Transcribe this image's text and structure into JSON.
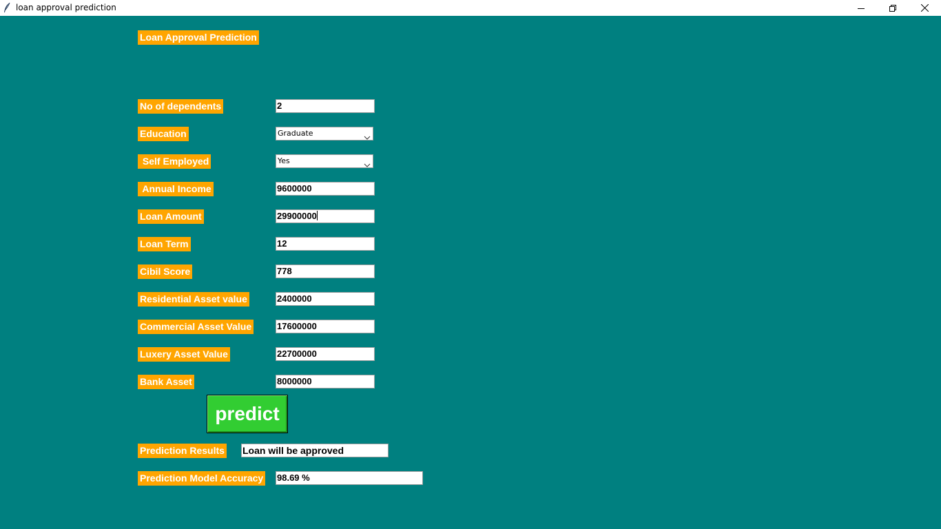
{
  "window": {
    "title": "loan approval prediction"
  },
  "header": {
    "title": "Loan Approval Prediction"
  },
  "form": {
    "dependents_label": "No of dependents",
    "dependents_value": "2",
    "education_label": "Education",
    "education_value": "Graduate",
    "self_employed_label": " Self Employed",
    "self_employed_value": "Yes",
    "annual_income_label": " Annual Income",
    "annual_income_value": "9600000",
    "loan_amount_label": "Loan Amount",
    "loan_amount_value": "29900000",
    "loan_term_label": "Loan Term",
    "loan_term_value": "12",
    "cibil_label": "Cibil Score",
    "cibil_value": "778",
    "residential_label": "Residential Asset value",
    "residential_value": "2400000",
    "commercial_label": "Commercial Asset Value",
    "commercial_value": "17600000",
    "luxury_label": "Luxery Asset Value",
    "luxury_value": "22700000",
    "bank_label": "Bank Asset",
    "bank_value": "8000000"
  },
  "actions": {
    "predict_label": "predict"
  },
  "results": {
    "result_label": "Prediction Results",
    "result_value": "Loan will be approved",
    "accuracy_label": "Prediction Model Accuracy",
    "accuracy_value": "98.69 %"
  },
  "colors": {
    "background": "#008080",
    "label_bg": "#FFA500",
    "button_bg": "#32CD32"
  },
  "icons": {
    "app": "feather-icon",
    "minimize": "minimize-icon",
    "maximize": "restore-icon",
    "close": "close-icon"
  }
}
